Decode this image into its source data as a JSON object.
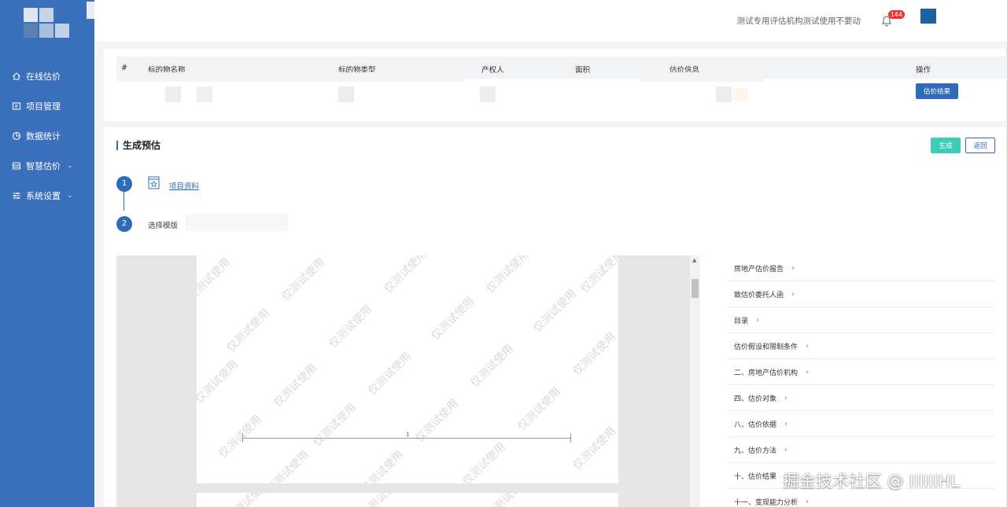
{
  "colors": {
    "sidebar": "#3a6fbc",
    "primary": "#2f6bb6",
    "generate": "#3ccdb8",
    "badge": "#e33333"
  },
  "sidebar": {
    "items": [
      {
        "label": "在线估价",
        "icon": "home-icon",
        "chevron": false
      },
      {
        "label": "项目管理",
        "icon": "folder-icon",
        "chevron": false
      },
      {
        "label": "数据统计",
        "icon": "pie-chart-icon",
        "chevron": false
      },
      {
        "label": "智慧估价",
        "icon": "database-icon",
        "chevron": true
      },
      {
        "label": "系统设置",
        "icon": "sliders-icon",
        "chevron": true
      }
    ]
  },
  "header": {
    "org_name": "测试专用评估机构测试使用不要动",
    "notification_count": "144"
  },
  "table": {
    "headers": [
      "#",
      "标的物名称",
      "标的物类型",
      "产权人",
      "面积",
      "估价信息",
      "操作"
    ],
    "action_label": "估价结果"
  },
  "main": {
    "title": "生成预估",
    "generate_label": "生成",
    "back_label": "返回",
    "steps": [
      {
        "number": "1",
        "label": "项目资料"
      },
      {
        "number": "2",
        "label": "选择模版"
      }
    ]
  },
  "preview": {
    "watermark_text": "仅测试使用",
    "page_number": "1"
  },
  "outline": {
    "items": [
      "房地产估价报告",
      "致估价委托人函",
      "目录",
      "估价假设和限制条件",
      "二、房地产估价机构",
      "四、估价对象",
      "八、估价依据",
      "九、估价方法",
      "十、估价结果",
      "十一、变现能力分析"
    ]
  },
  "credit": "掘金技术社区 @ IIIIIIHL"
}
